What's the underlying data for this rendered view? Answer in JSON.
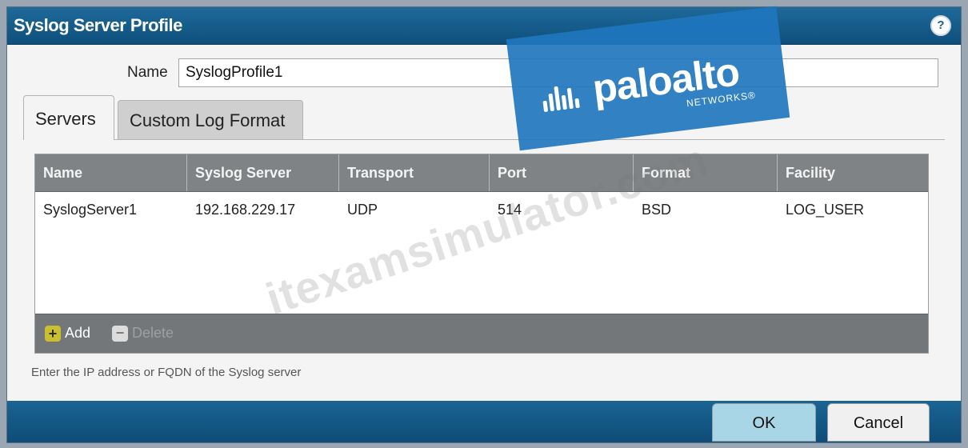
{
  "dialog": {
    "title": "Syslog Server Profile",
    "help_icon": "question-mark-icon"
  },
  "form": {
    "name_label": "Name",
    "name_value": "SyslogProfile1"
  },
  "tabs": [
    {
      "label": "Servers",
      "active": true
    },
    {
      "label": "Custom Log Format",
      "active": false
    }
  ],
  "grid": {
    "columns": [
      "Name",
      "Syslog Server",
      "Transport",
      "Port",
      "Format",
      "Facility"
    ],
    "rows": [
      {
        "name": "SyslogServer1",
        "server": "192.168.229.17",
        "transport": "UDP",
        "port": "514",
        "format": "BSD",
        "facility": "LOG_USER"
      }
    ],
    "add_label": "Add",
    "delete_label": "Delete"
  },
  "hint": "Enter the IP address or FQDN of the Syslog server",
  "buttons": {
    "ok": "OK",
    "cancel": "Cancel"
  },
  "logo": {
    "brand": "paloalto",
    "sub": "NETWORKS®"
  },
  "watermark": "itexamsimulator.com",
  "colors": {
    "titlebar": "#1e6a9a",
    "grid_header": "#7f8386",
    "ok_button": "#a9d6e6",
    "logo_blue": "#1f76be"
  }
}
